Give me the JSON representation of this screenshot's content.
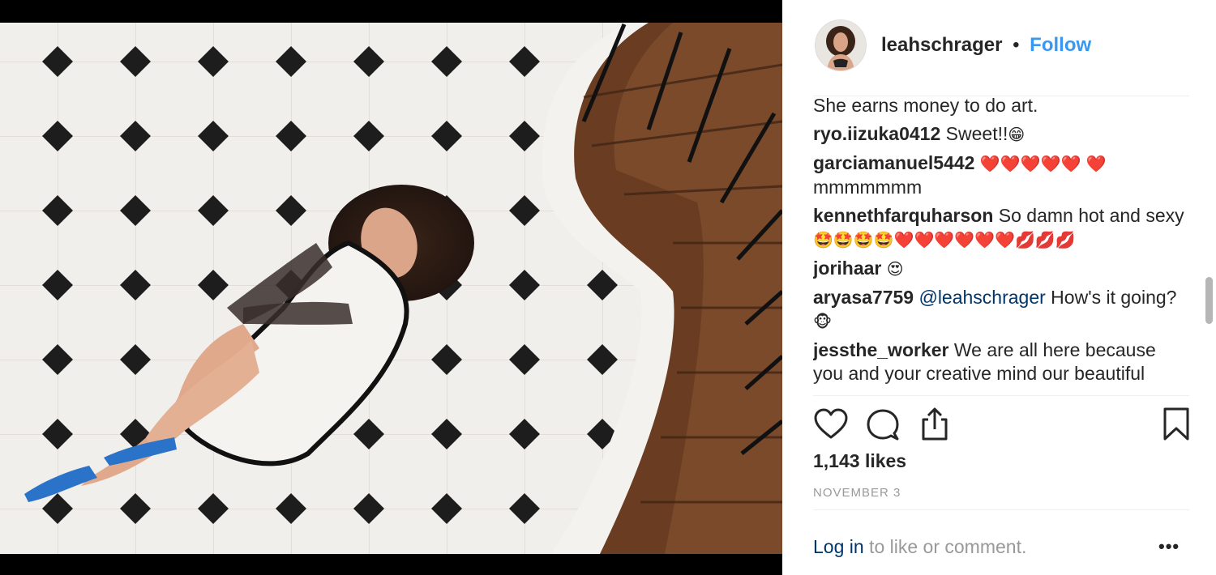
{
  "post": {
    "username": "leahschrager",
    "separator": "•",
    "follow_label": "Follow",
    "likes": "1,143 likes",
    "date": "NOVEMBER 3",
    "login_link": "Log in",
    "login_rest": " to like or comment.",
    "more_label": "•••"
  },
  "comments": [
    {
      "user": "",
      "text": "She earns money to do art."
    },
    {
      "user": "ryo.iizuka0412",
      "text": " Sweet!!",
      "emoji": "😁"
    },
    {
      "user": "garciamanuel5442",
      "text": " ",
      "emoji": "❤️❤️❤️❤️❤️ ❤️",
      "text2": "mmmmmmm"
    },
    {
      "user": "kennethfarquharson",
      "text": " So damn hot and sexy ",
      "emoji": "🤩🤩🤩🤩❤️❤️❤️❤️❤️❤️💋💋💋"
    },
    {
      "user": "jorihaar",
      "text": " ",
      "emoji": "😍"
    },
    {
      "user": "aryasa7759",
      "mention": " @leahschrager",
      "text": " How's it going?",
      "emoji": "🐵"
    },
    {
      "user": "jessthe_worker",
      "text": " We are all here because you and your creative mind our beautiful"
    }
  ],
  "icons": {
    "like": "heart-icon",
    "comment": "speech-bubble-icon",
    "share": "share-upload-icon",
    "save": "bookmark-icon"
  },
  "colors": {
    "follow": "#3897f0",
    "link": "#003569",
    "muted": "#999999",
    "text": "#262626"
  }
}
